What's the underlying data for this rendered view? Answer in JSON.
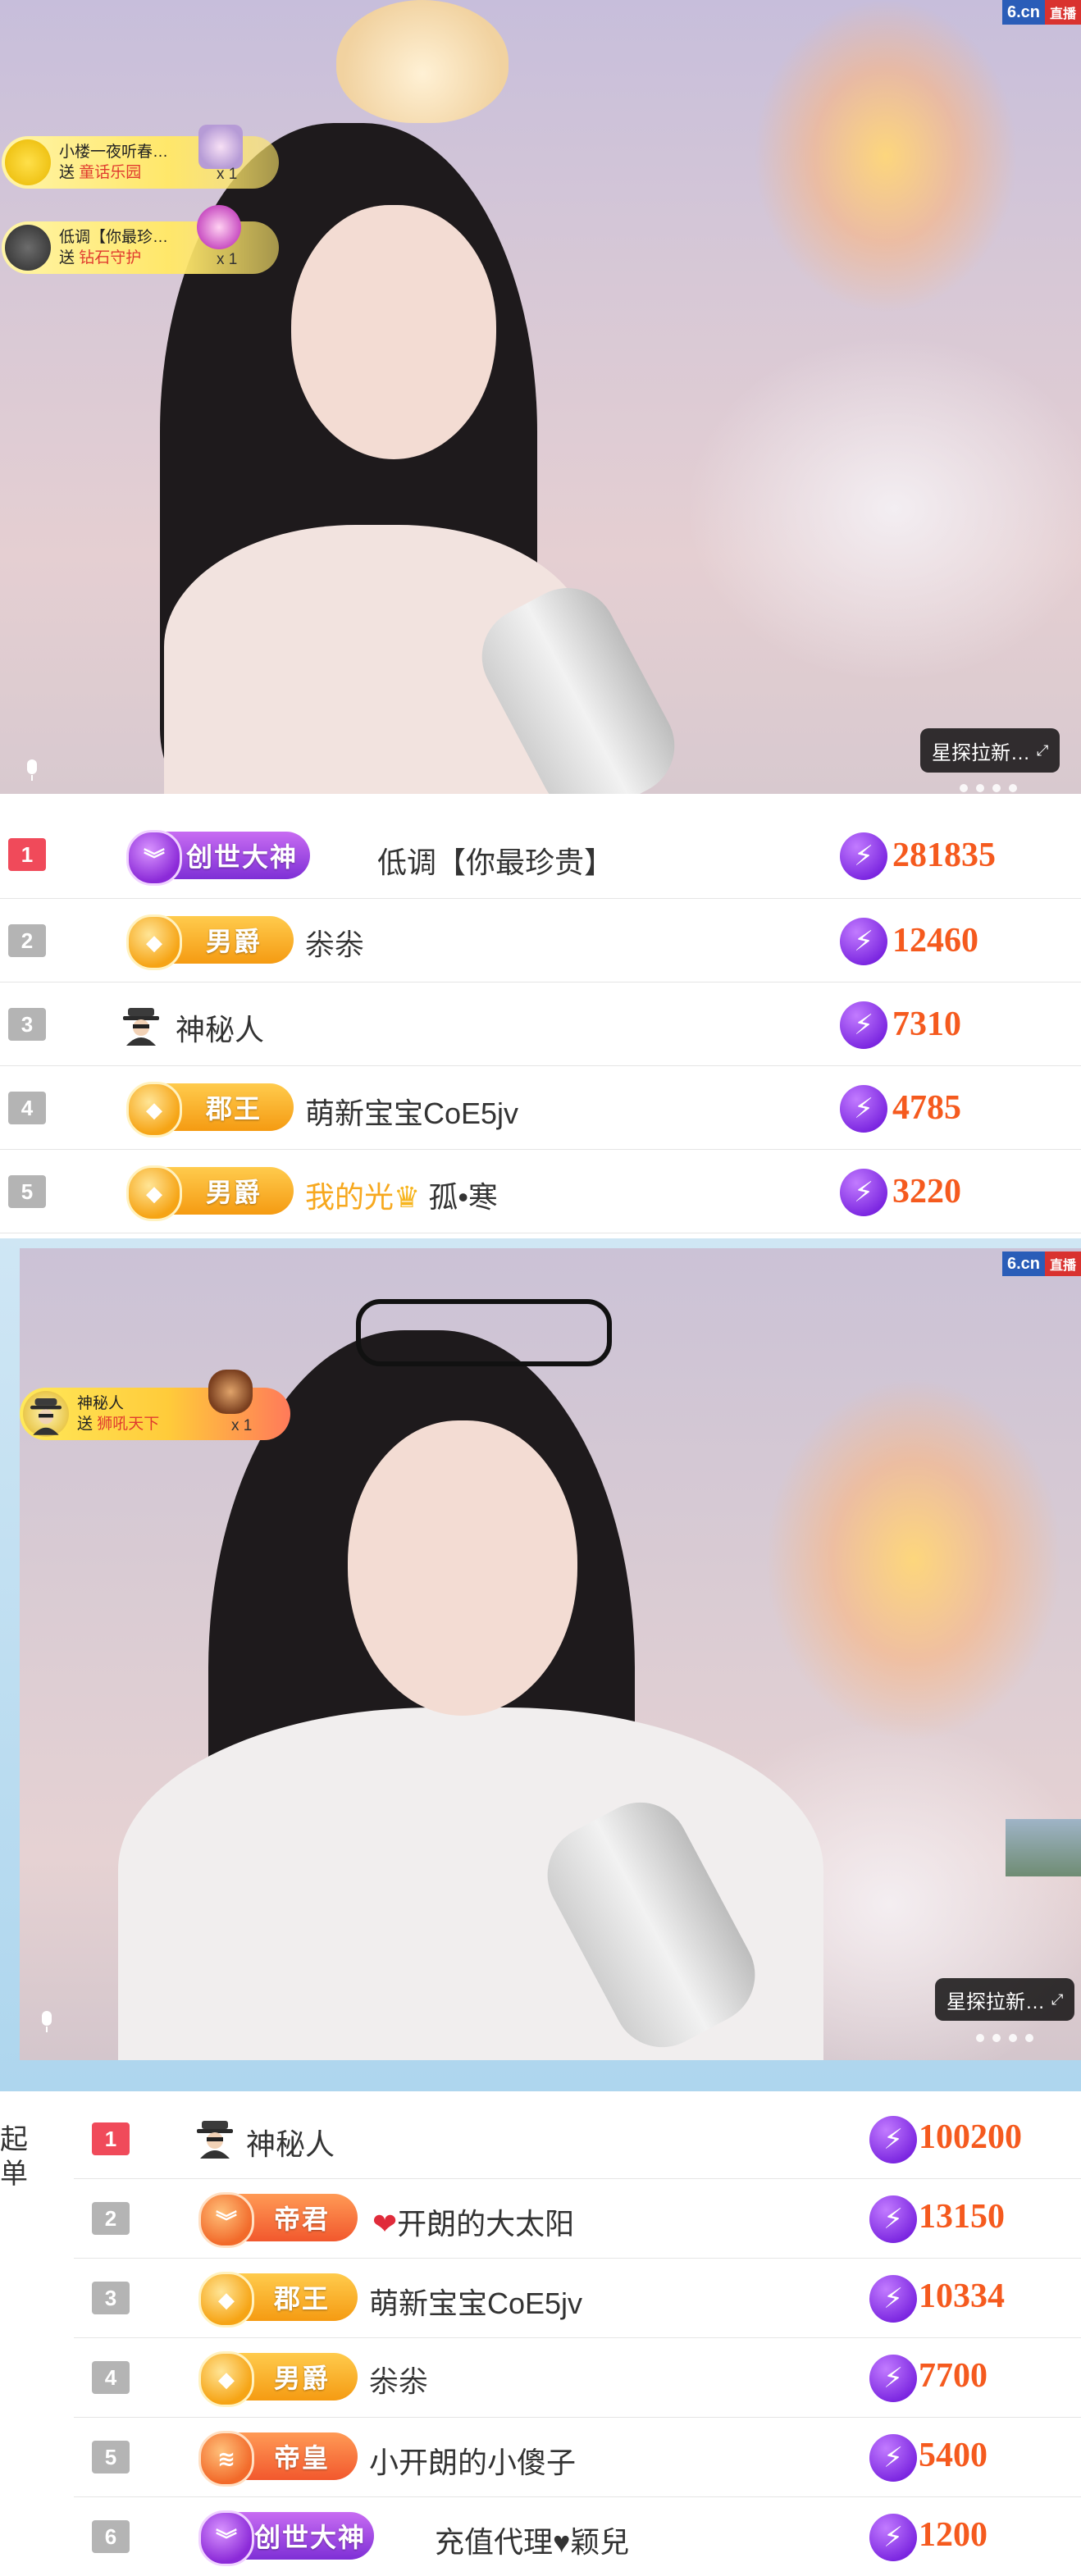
{
  "brand": {
    "logo": "6.cn",
    "live_tag": "直播"
  },
  "stream_top": {
    "gift_toasts": [
      {
        "user": "小楼一夜听春…",
        "send": "送",
        "gift": "童话乐园",
        "count": "x 1"
      },
      {
        "user": "低调【你最珍…",
        "send": "送",
        "gift": "钻石守护",
        "count": "x 1"
      }
    ],
    "explore_label": "星探拉新…",
    "arrow_icon": "expand-arrow-icon"
  },
  "ranking_top": [
    {
      "rank": "1",
      "badge": "创世大神",
      "badge_color": "purple",
      "name": "低调【你最珍贵】",
      "score": "281835"
    },
    {
      "rank": "2",
      "badge": "男爵",
      "badge_color": "gold",
      "name": "尜尜",
      "score": "12460"
    },
    {
      "rank": "3",
      "badge": "",
      "badge_color": "none",
      "name": "神秘人",
      "score": "7310"
    },
    {
      "rank": "4",
      "badge": "郡王",
      "badge_color": "gold",
      "name": "萌新宝宝CoE5jv",
      "score": "4785"
    },
    {
      "rank": "5",
      "badge": "男爵",
      "badge_color": "gold",
      "title": "我的光",
      "name": "孤•寒",
      "score": "3220"
    }
  ],
  "stream_bottom": {
    "gift_toast": {
      "user": "神秘人",
      "send": "送",
      "gift": "狮吼天下",
      "count": "x 1"
    },
    "explore_label": "星探拉新…"
  },
  "side_label": "起单",
  "ranking_bottom": [
    {
      "rank": "1",
      "badge": "",
      "badge_color": "none",
      "name": "神秘人",
      "score": "100200"
    },
    {
      "rank": "2",
      "badge": "帝君",
      "badge_color": "orange",
      "name": "开朗的大太阳",
      "score": "13150"
    },
    {
      "rank": "3",
      "badge": "郡王",
      "badge_color": "gold",
      "name": "萌新宝宝CoE5jv",
      "score": "10334"
    },
    {
      "rank": "4",
      "badge": "男爵",
      "badge_color": "gold",
      "name": "尜尜",
      "score": "7700"
    },
    {
      "rank": "5",
      "badge": "帝皇",
      "badge_color": "orange",
      "name": "小开朗的小傻子",
      "score": "5400"
    },
    {
      "rank": "6",
      "badge": "创世大神",
      "badge_color": "purple",
      "name": "充值代理♥颖兒",
      "score": "1200"
    }
  ],
  "colors": {
    "score": "#f55a1e",
    "rank_first": "#f04a5a",
    "rank_other": "#b4b4b4",
    "brand_blue": "#2a5db8",
    "brand_red": "#d9322f"
  }
}
